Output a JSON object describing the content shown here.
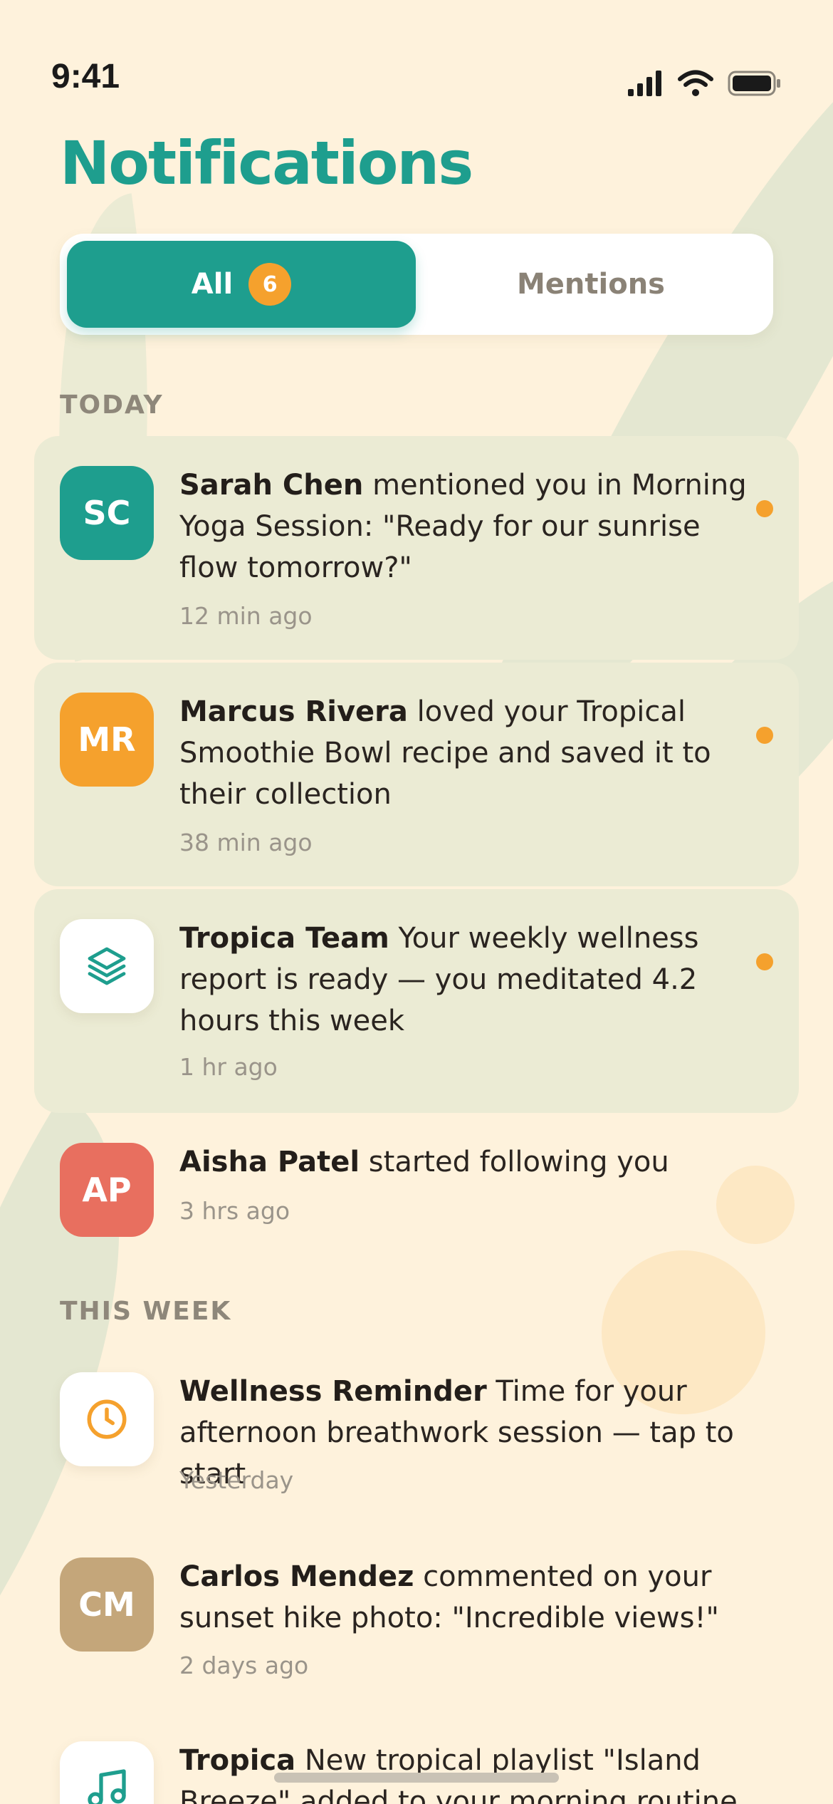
{
  "status_bar": {
    "time": "9:41"
  },
  "header": {
    "title": "Notifications"
  },
  "tabs": [
    {
      "label": "All",
      "badge": "6",
      "active": true
    },
    {
      "label": "Mentions",
      "active": false
    }
  ],
  "sections": {
    "today": "TODAY",
    "this_week": "THIS WEEK"
  },
  "notifications": [
    {
      "initials": "SC",
      "avatar_color": "#1E9E8E",
      "name": "Sarah Chen",
      "text": " mentioned you in Morning Yoga Session: \"Ready for our sunrise flow tomorrow?\"",
      "time": "12 min ago",
      "unread": true
    },
    {
      "initials": "MR",
      "avatar_color": "#F5A12D",
      "name": "Marcus Rivera",
      "text": " loved your Tropical Smoothie Bowl recipe and saved it to their collection",
      "time": "38 min ago",
      "unread": true
    },
    {
      "icon": "layers-icon",
      "name": "Tropica Team",
      "text": " Your weekly wellness report is ready — you meditated 4.2 hours this week",
      "time": "1 hr ago",
      "unread": true
    },
    {
      "initials": "AP",
      "avatar_color": "#E86F5F",
      "name": "Aisha Patel",
      "text": " started following you",
      "time": "3 hrs ago",
      "unread": false
    },
    {
      "icon": "clock-icon",
      "name": "Wellness Reminder",
      "text": " Time for your afternoon breathwork session — tap to start",
      "time": "Yesterday",
      "unread": false
    },
    {
      "initials": "CM",
      "avatar_color": "#C4A67A",
      "name": "Carlos Mendez",
      "text": " commented on your sunset hike photo: \"Incredible views!\"",
      "time": "2 days ago",
      "unread": false
    },
    {
      "icon": "music-note-icon",
      "name": "Tropica",
      "text": " New tropical playlist \"Island Breeze\" added to your morning routine library",
      "time": "",
      "unread": false
    }
  ],
  "colors": {
    "accent": "#1E9E8E",
    "unread_dot": "#F5A12D",
    "background": "#FEF2DC",
    "unread_card": "#EBEBD4"
  }
}
